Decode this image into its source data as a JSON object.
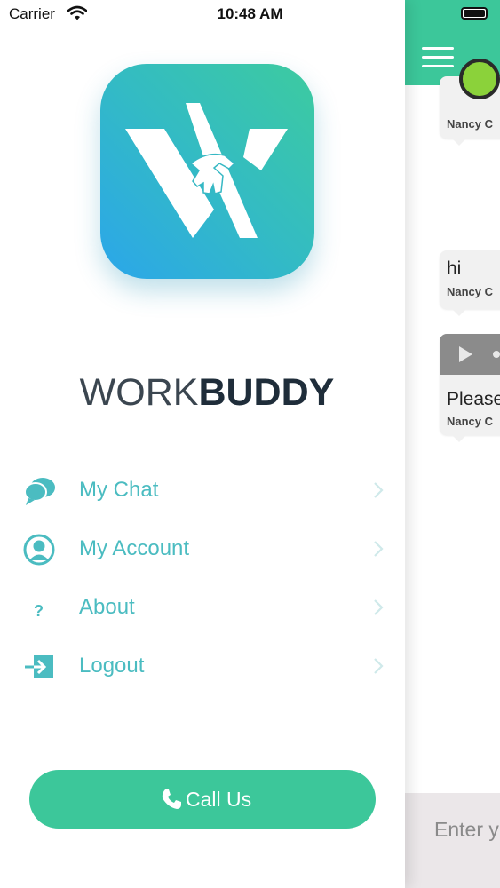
{
  "status_bar": {
    "carrier": "Carrier",
    "time": "10:48 AM"
  },
  "drawer": {
    "brand": {
      "part1": "WORK",
      "part2": "BUDDY"
    },
    "menu": [
      {
        "label": "My Chat",
        "icon": "chat-bubbles-icon"
      },
      {
        "label": "My Account",
        "icon": "user-circle-icon"
      },
      {
        "label": "About",
        "icon": "question-icon"
      },
      {
        "label": "Logout",
        "icon": "logout-icon"
      }
    ],
    "call_button": {
      "label": "Call Us",
      "icon": "phone-icon"
    }
  },
  "chat": {
    "messages": [
      {
        "text": "",
        "sender": "Nancy C"
      },
      {
        "text": "hi",
        "sender": "Nancy C"
      },
      {
        "text": "Please",
        "sender": "Nancy C"
      }
    ],
    "input_placeholder": "Enter y"
  },
  "colors": {
    "accent_green": "#3cc79a",
    "menu_text": "#4bbcc1",
    "logo_gradient_start": "#2ba6ea",
    "logo_gradient_end": "#3dcb9f",
    "brand_dark": "#1f2d3a"
  }
}
